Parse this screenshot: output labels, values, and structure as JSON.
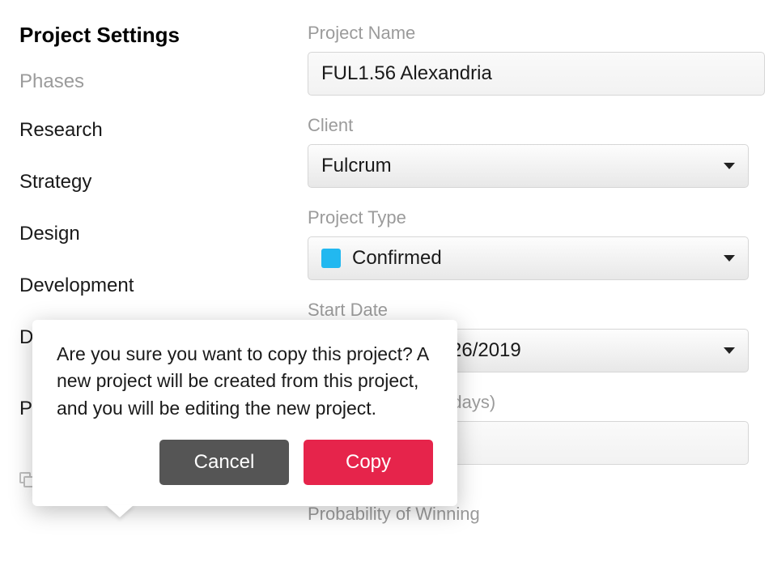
{
  "sidebar": {
    "title": "Project Settings",
    "phases_label": "Phases",
    "items": [
      {
        "label": "Research"
      },
      {
        "label": "Strategy"
      },
      {
        "label": "Design"
      },
      {
        "label": "Development"
      },
      {
        "label": "D"
      }
    ],
    "partial_p": "P",
    "create_copy_label": "Create a Copy"
  },
  "form": {
    "project_name": {
      "label": "Project Name",
      "value": "FUL1.56 Alexandria"
    },
    "client": {
      "label": "Client",
      "value": "Fulcrum"
    },
    "project_type": {
      "label": "Project Type",
      "value": "Confirmed"
    },
    "start_date": {
      "label": "Start Date",
      "value": "26/2019"
    },
    "days_partial": "g days)",
    "probability_label": "Probability of Winning"
  },
  "popover": {
    "message": "Are you sure you want to copy this project? A new project will be created from this project, and you will be editing the new project.",
    "cancel_label": "Cancel",
    "copy_label": "Copy"
  },
  "colors": {
    "accent": "#e6244b",
    "muted": "#9b9b9b",
    "swatch": "#22b8f0"
  }
}
